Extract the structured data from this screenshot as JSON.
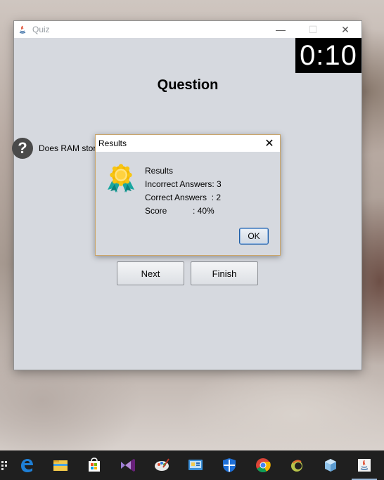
{
  "window": {
    "title": "Quiz",
    "controls": {
      "minimize": "—",
      "maximize": "☐",
      "close": "✕"
    }
  },
  "timer": "0:10",
  "question": {
    "heading": "Question",
    "icon": "?",
    "text": "Does RAM stor                                                                                             osec"
  },
  "buttons": {
    "next": "Next",
    "finish": "Finish"
  },
  "dialog": {
    "title": "Results",
    "close": "✕",
    "icon": "medal-icon",
    "lines": {
      "heading": "Results",
      "incorrect": "Incorrect Answers: 3",
      "correct": "Correct Answers  : 2",
      "score_label": "Score",
      "score_value": ": 40%"
    },
    "ok": "OK"
  },
  "taskbar": {
    "items": [
      "task-view-icon",
      "edge-icon",
      "file-explorer-icon",
      "store-icon",
      "visual-studio-icon",
      "paint-icon",
      "control-panel-icon",
      "defender-icon",
      "chrome-icon",
      "eclipse-icon",
      "virtualbox-icon",
      "java-icon"
    ],
    "accent": "#9ab7d8"
  }
}
